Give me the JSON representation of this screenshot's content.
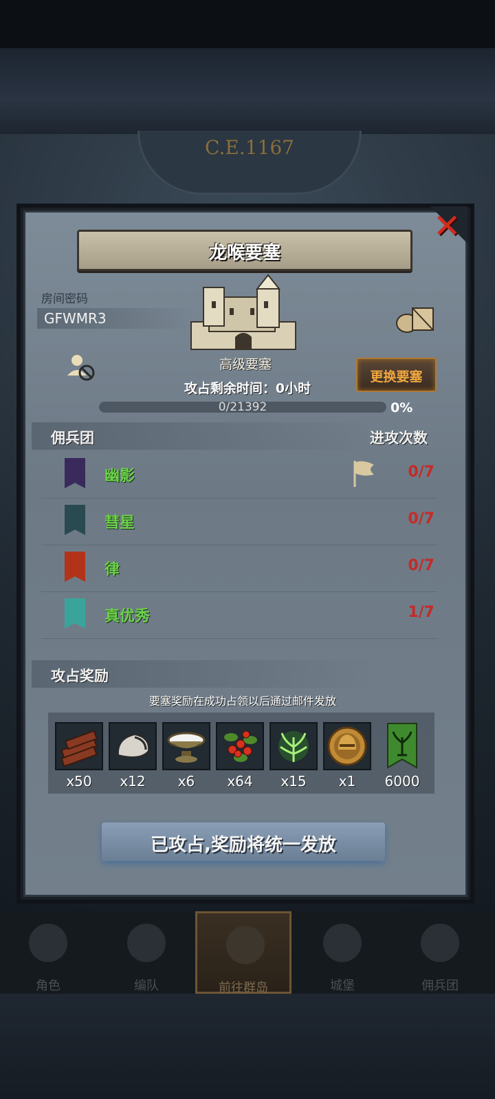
{
  "header": {
    "year": "C.E.1167"
  },
  "dialog": {
    "title": "龙喉要塞",
    "room_code_label": "房间密码",
    "room_code": "GFWMR3",
    "fortress_name": "高级要塞",
    "time_label": "攻占剩余时间：0小时",
    "change_button": "更换要塞",
    "progress": {
      "text": "0/21392",
      "percent_text": "0%",
      "fraction": 0
    },
    "mercenary_header": "佣兵团",
    "attack_header": "进攻次数",
    "rows": [
      {
        "name": "幽影",
        "count": "0/7",
        "banner_color": "#3a2a5c",
        "flag": true
      },
      {
        "name": "彗星",
        "count": "0/7",
        "banner_color": "#2a4a52",
        "flag": false
      },
      {
        "name": "律",
        "count": "0/7",
        "banner_color": "#b2331a",
        "flag": false
      },
      {
        "name": "真优秀",
        "count": "1/7",
        "banner_color": "#3aa49a",
        "flag": false
      }
    ],
    "rewards_header": "攻占奖励",
    "rewards_note": "要塞奖励在成功占领以后通过邮件发放",
    "rewards": [
      {
        "icon": "wood-icon",
        "qty": "x50"
      },
      {
        "icon": "stone-icon",
        "qty": "x12"
      },
      {
        "icon": "bowl-icon",
        "qty": "x6"
      },
      {
        "icon": "berries-icon",
        "qty": "x64"
      },
      {
        "icon": "herb-icon",
        "qty": "x15"
      },
      {
        "icon": "helmet-coin-icon",
        "qty": "x1"
      },
      {
        "icon": "tree-banner-icon",
        "qty": "6000"
      }
    ],
    "claim_text": "已攻占,奖励将统一发放"
  },
  "tabs": [
    {
      "label": "角色",
      "active": false
    },
    {
      "label": "编队",
      "active": false
    },
    {
      "label": "前往群岛",
      "active": true
    },
    {
      "label": "城堡",
      "active": false
    },
    {
      "label": "佣兵团",
      "active": false
    }
  ],
  "colors": {
    "accent_orange": "#f0a640",
    "count_red": "#c42b28",
    "name_green": "#6bd14a"
  }
}
